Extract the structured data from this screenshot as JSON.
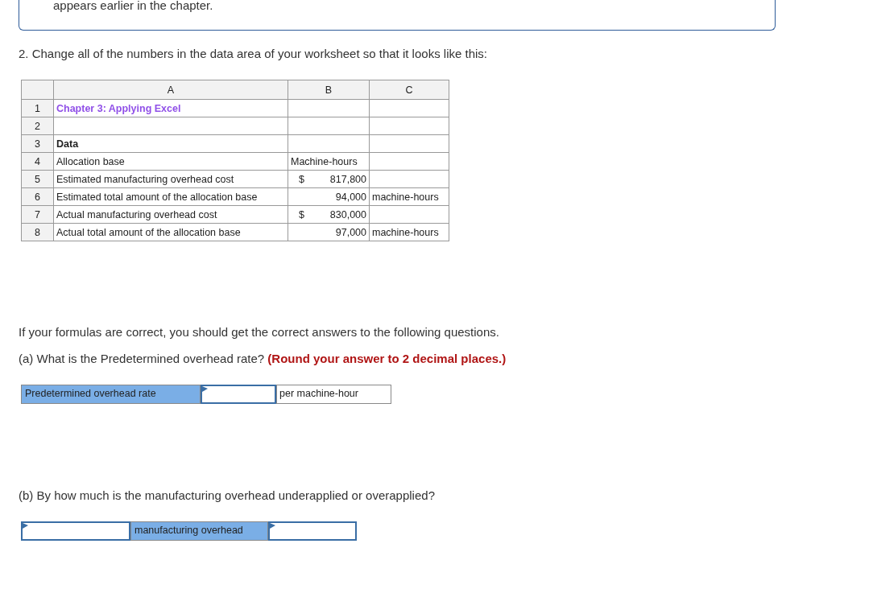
{
  "intro_box": {
    "text": "appears earlier in the chapter."
  },
  "instruction": "2. Change all of the numbers in the data area of your worksheet so that it looks like this:",
  "spreadsheet": {
    "columns": [
      "A",
      "B",
      "C"
    ],
    "rows": [
      {
        "number": "1",
        "kind": "title",
        "a": "Chapter 3: Applying Excel"
      },
      {
        "number": "2",
        "kind": "text"
      },
      {
        "number": "3",
        "kind": "heading",
        "a": "Data"
      },
      {
        "number": "4",
        "kind": "text",
        "a": "Allocation base",
        "b": "Machine-hours"
      },
      {
        "number": "5",
        "kind": "amount",
        "a": "Estimated manufacturing overhead cost",
        "currency": "$",
        "b": "817,800"
      },
      {
        "number": "6",
        "kind": "amount",
        "a": "Estimated total amount of the allocation base",
        "b": "94,000",
        "c": "machine-hours"
      },
      {
        "number": "7",
        "kind": "amount",
        "a": "Actual manufacturing overhead cost",
        "currency": "$",
        "b": "830,000"
      },
      {
        "number": "8",
        "kind": "amount",
        "a": "Actual total amount of the allocation base",
        "b": "97,000",
        "c": "machine-hours"
      }
    ]
  },
  "note": "If your formulas are correct, you should get the correct answers to the following questions.",
  "questions": [
    {
      "prompt": "(a) What is the Predetermined overhead rate? **(Round your answer to 2 decimal places.)**",
      "answer_row": [
        {
          "kind": "label",
          "text": "Predetermined overhead rate"
        },
        {
          "kind": "input"
        },
        {
          "kind": "unit",
          "text": "per machine-hour"
        }
      ]
    },
    {
      "prompt": "(b) By how much is the manufacturing overhead underapplied or overapplied?",
      "answer_row": [
        {
          "kind": "input"
        },
        {
          "kind": "label",
          "text": "manufacturing overhead"
        },
        {
          "kind": "input"
        }
      ]
    }
  ]
}
